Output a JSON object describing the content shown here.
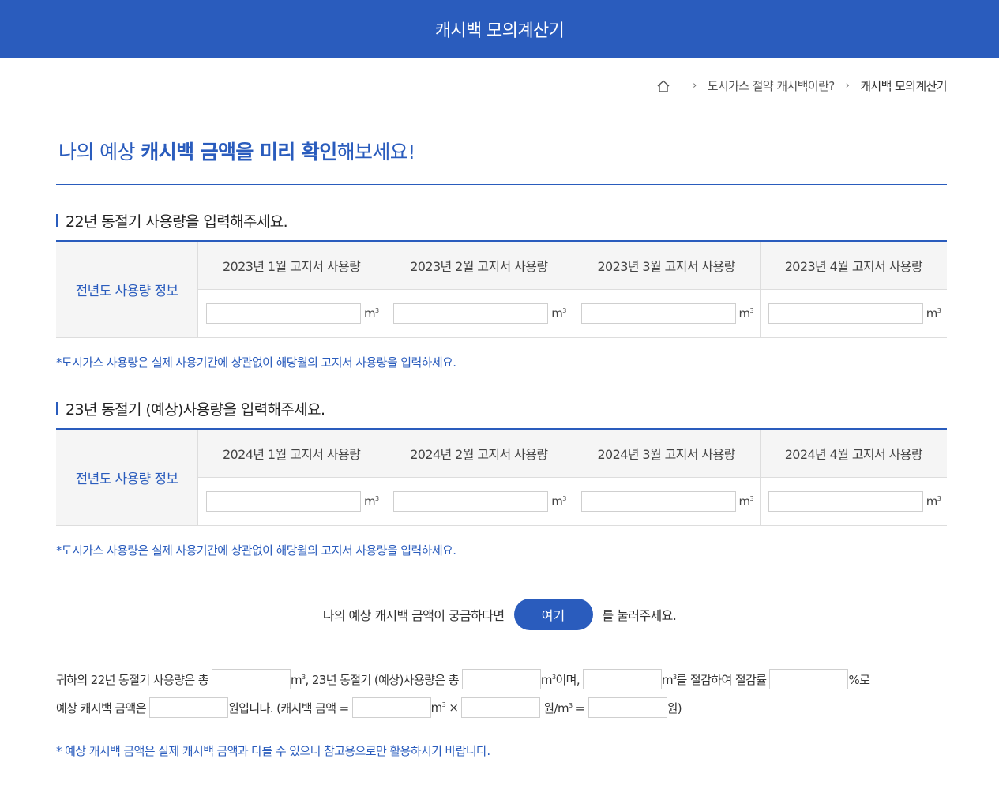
{
  "header": {
    "title": "캐시백 모의계산기"
  },
  "breadcrumb": {
    "home_icon": "home-icon",
    "items": [
      "도시가스 절약 캐시백이란?",
      "캐시백 모의계산기"
    ],
    "separator": "›"
  },
  "hero": {
    "prefix": "나의 예상 ",
    "emphasis": "캐시백 금액을 미리 확인",
    "suffix": "해보세요!"
  },
  "section1": {
    "title": "22년 동절기 사용량을 입력해주세요.",
    "row_header": "전년도 사용량 정보",
    "columns": [
      "2023년 1월 고지서 사용량",
      "2023년 2월 고지서 사용량",
      "2023년 3월 고지서 사용량",
      "2023년 4월 고지서 사용량"
    ],
    "values": [
      "",
      "",
      "",
      ""
    ],
    "note": "*도시가스 사용량은 실제 사용기간에 상관없이 해당월의 고지서 사용량을 입력하세요."
  },
  "section2": {
    "title": "23년 동절기 (예상)사용량을 입력해주세요.",
    "row_header": "전년도 사용량 정보",
    "columns": [
      "2024년 1월 고지서 사용량",
      "2024년 2월 고지서 사용량",
      "2024년 3월 고지서 사용량",
      "2024년 4월 고지서 사용량"
    ],
    "values": [
      "",
      "",
      "",
      ""
    ],
    "note": "*도시가스 사용량은 실제 사용기간에 상관없이 해당월의 고지서 사용량을 입력하세요."
  },
  "unit": {
    "base": "m",
    "sup": "3"
  },
  "prompt": {
    "before": "나의 예상 캐시백 금액이 궁금하다면",
    "button": "여기",
    "after": "를 눌러주세요."
  },
  "result": {
    "line1": [
      "귀하의 22년 동절기 사용량은 총",
      "m",
      "3",
      ", 23년 동절기 (예상)사용량은 총",
      "m",
      "3",
      "이며,",
      "m",
      "3",
      "를 절감하여 절감률",
      "%로"
    ],
    "line2": [
      "예상 캐시백 금액은",
      "원입니다. (캐시백 금액 =",
      "m",
      "3",
      " ×",
      "원/m",
      "3",
      " =",
      "원)"
    ]
  },
  "footnote": "* 예상 캐시백 금액은 실제 캐시백 금액과 다를 수 있으니 참고용으로만 활용하시기 바랍니다.",
  "colors": {
    "accent": "#2a5cbd",
    "header_bg": "#2a5cbd",
    "table_head_bg": "#f5f5f5"
  }
}
